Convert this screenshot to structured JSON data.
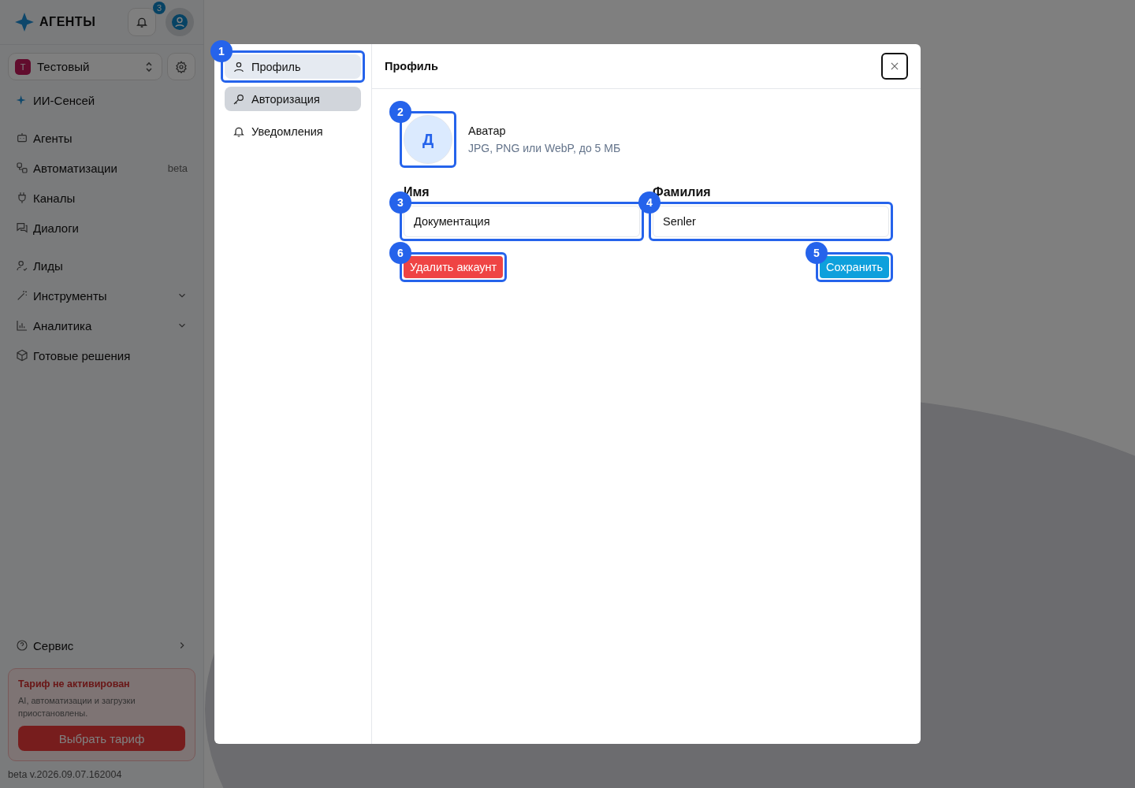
{
  "sidebar": {
    "logo": "АГЕНТЫ",
    "notification_count": "3",
    "workspace": {
      "initial": "Т",
      "name": "Тестовый"
    },
    "ai_item": "ИИ-Сенсей",
    "nav_groups": [
      [
        {
          "label": "Агенты",
          "kind": "link"
        },
        {
          "label": "Автоматизации",
          "kind": "link",
          "badge": "beta"
        },
        {
          "label": "Каналы",
          "kind": "link"
        },
        {
          "label": "Диалоги",
          "kind": "link"
        }
      ],
      [
        {
          "label": "Лиды",
          "kind": "link"
        },
        {
          "label": "Инструменты",
          "kind": "group",
          "expanded": false
        },
        {
          "label": "Аналитика",
          "kind": "group",
          "expanded": false
        },
        {
          "label": "Готовые решения",
          "kind": "link"
        }
      ]
    ],
    "service": "Сервис",
    "plan_card": {
      "title": "Тариф не активирован",
      "text": "AI, автоматизации и загрузки приостановлены.",
      "button": "Выбрать тариф"
    },
    "version": "beta v.2026.09.07.162004"
  },
  "modal": {
    "nav": [
      {
        "label": "Профиль",
        "selected": true,
        "hovered": false,
        "marker": "1"
      },
      {
        "label": "Авторизация",
        "selected": false,
        "hovered": true
      },
      {
        "label": "Уведомления",
        "selected": false,
        "hovered": false
      }
    ],
    "title": "Профиль",
    "avatar": {
      "initial": "Д",
      "marker": "2",
      "label": "Аватар",
      "hint": "JPG, PNG или WebP, до 5 МБ"
    },
    "fields": [
      {
        "label": "Имя",
        "value": "Документация",
        "marker": "3"
      },
      {
        "label": "Фамилия",
        "value": "Senler",
        "marker": "4"
      }
    ],
    "delete_button": {
      "label": "Удалить аккаунт",
      "marker": "6"
    },
    "save_button": {
      "label": "Сохранить",
      "marker": "5"
    }
  }
}
